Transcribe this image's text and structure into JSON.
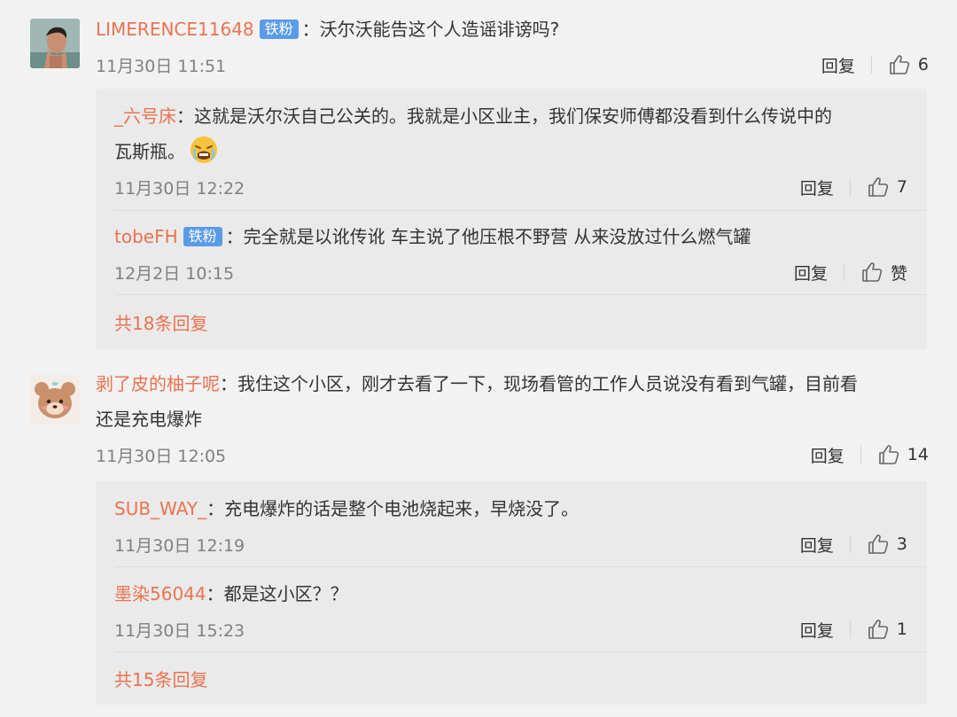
{
  "comments": [
    {
      "username": "LIMERENCE11648",
      "badge": "铁粉",
      "text": "：沃尔沃能告这个人造谣诽谤吗?",
      "time": "11月30日 11:51",
      "reply_label": "回复",
      "likes": "6",
      "replies": [
        {
          "username": "_六号床",
          "text_line1": "：这就是沃尔沃自己公关的。我就是小区业主，我们保安师傅都没看到什么传说中的",
          "text_line2": "瓦斯瓶。",
          "emoji": "weary-face-emoji",
          "time": "11月30日 12:22",
          "reply_label": "回复",
          "likes": "7"
        },
        {
          "username": "tobeFH",
          "badge": "铁粉",
          "text": "：完全就是以讹传讹 车主说了他压根不野营 从来没放过什么燃气罐",
          "time": "12月2日 10:15",
          "reply_label": "回复",
          "likes": "赞"
        }
      ],
      "total_replies": "共18条回复"
    },
    {
      "username": "剥了皮的柚子呢",
      "text_line1": "：我住这个小区，刚才去看了一下，现场看管的工作人员说没有看到气罐，目前看",
      "text_line2": "还是充电爆炸",
      "time": "11月30日 12:05",
      "reply_label": "回复",
      "likes": "14",
      "replies": [
        {
          "username": "SUB_WAY_",
          "text": "：充电爆炸的话是整个电池烧起来，早烧没了。",
          "time": "11月30日 12:19",
          "reply_label": "回复",
          "likes": "3"
        },
        {
          "username": "墨染56044",
          "text": "：都是这小区？？",
          "time": "11月30日 15:23",
          "reply_label": "回复",
          "likes": "1"
        }
      ],
      "total_replies": "共15条回复"
    }
  ],
  "colors": {
    "username": "#eb7350",
    "badge": "#5a9be8",
    "time": "#808080",
    "reply_bg": "#eaeaea",
    "page_bg": "#f2f2f2"
  }
}
